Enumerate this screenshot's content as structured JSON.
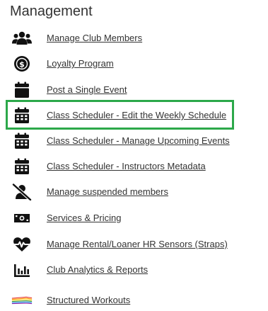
{
  "section": {
    "title": "Management"
  },
  "menu": {
    "items": [
      {
        "label": "Manage Club Members",
        "icon": "users-icon"
      },
      {
        "label": "Loyalty Program",
        "icon": "dollar-coin-icon"
      },
      {
        "label": "Post a Single Event",
        "icon": "calendar-icon"
      },
      {
        "label": "Class Scheduler - Edit the Weekly Schedule",
        "icon": "calendar-grid-icon"
      },
      {
        "label": "Class Scheduler - Manage Upcoming Events",
        "icon": "calendar-grid-icon"
      },
      {
        "label": "Class Scheduler - Instructors Metadata",
        "icon": "calendar-grid-icon"
      },
      {
        "label": "Manage suspended members",
        "icon": "user-slash-icon"
      },
      {
        "label": "Services & Pricing",
        "icon": "money-bill-icon"
      },
      {
        "label": "Manage Rental/Loaner HR Sensors (Straps)",
        "icon": "heartbeat-icon"
      },
      {
        "label": "Club Analytics & Reports",
        "icon": "bar-chart-icon"
      },
      {
        "label": "Structured Workouts",
        "icon": "stacked-bars-icon"
      }
    ]
  },
  "highlight": {
    "color": "#2ca84a",
    "item_index": 3
  }
}
